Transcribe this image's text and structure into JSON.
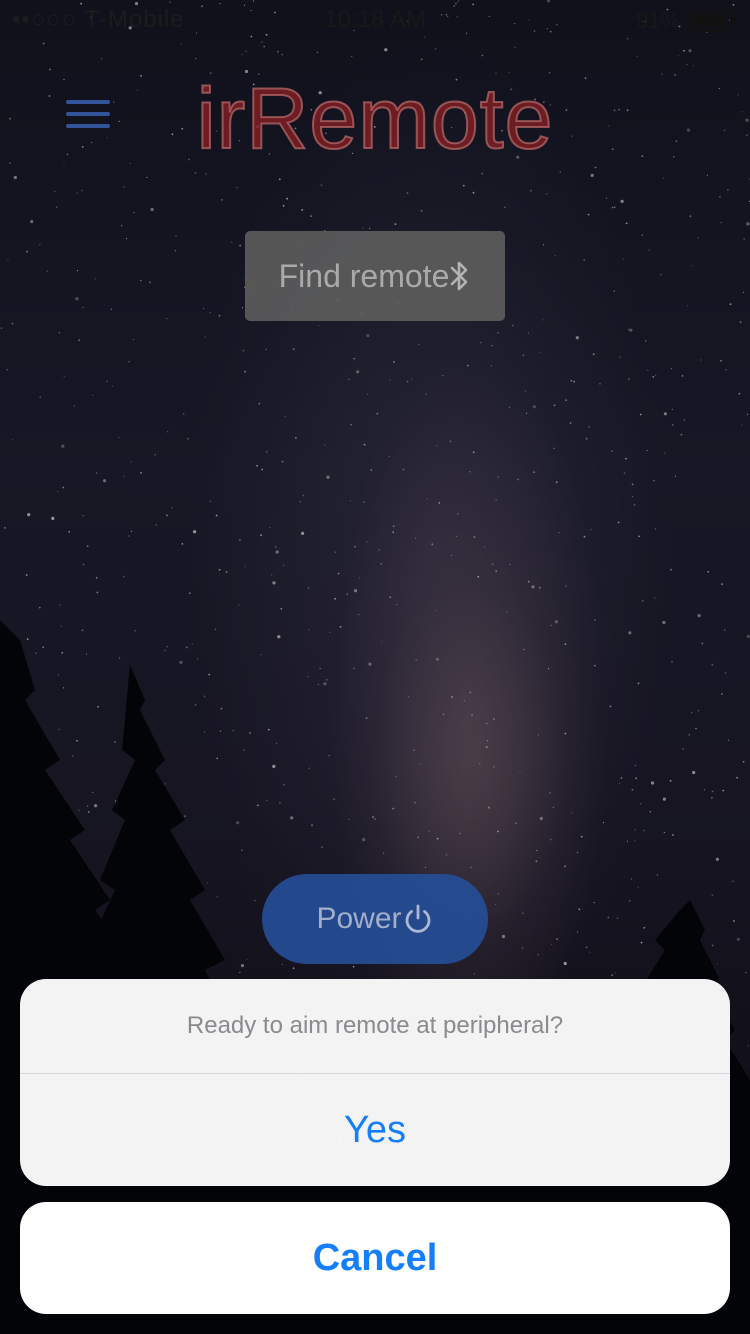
{
  "status_bar": {
    "carrier": "••○○○ T-Mobile",
    "time": "10:18 AM",
    "battery_percent_text": "91%",
    "battery_level": 0.91
  },
  "header": {
    "menu_icon": "hamburger-menu-icon",
    "title": "irRemote"
  },
  "find_remote": {
    "label": "Find remote",
    "icon": "bluetooth-icon"
  },
  "power": {
    "label": "Power",
    "icon": "power-icon"
  },
  "action_sheet": {
    "message": "Ready to aim remote at peripheral?",
    "yes_label": "Yes",
    "cancel_label": "Cancel"
  },
  "colors": {
    "accent": "#157efb",
    "title": "#7d1e23",
    "power_button": "#254d96",
    "find_button": "#5c5c5c"
  }
}
